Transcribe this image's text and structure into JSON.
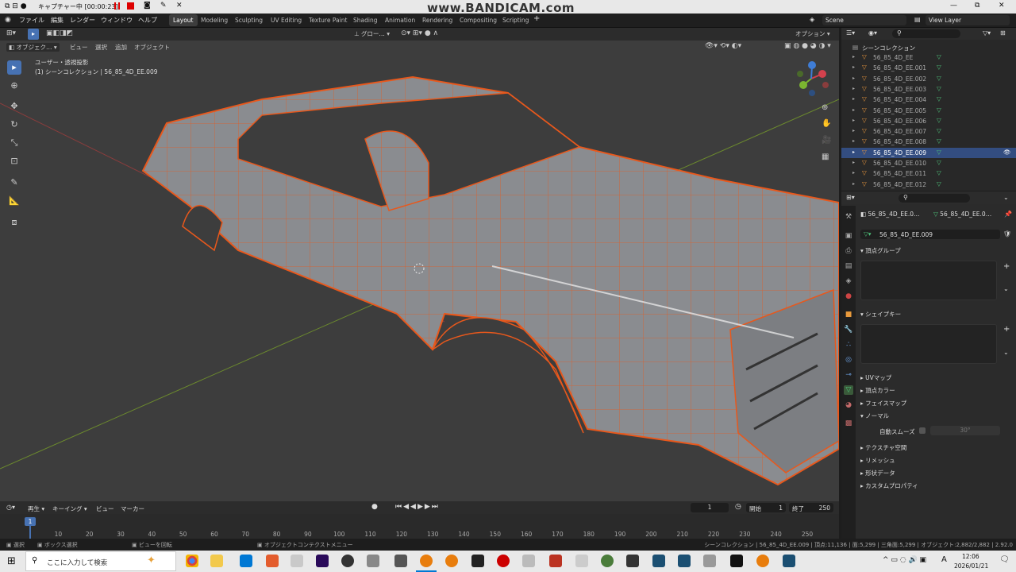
{
  "titlebar": {
    "capture": "キャプチャー中 [00:00:23]",
    "watermark": "www.BANDICAM.com"
  },
  "menu": [
    "ファイル",
    "編集",
    "レンダー",
    "ウィンドウ",
    "ヘルプ"
  ],
  "workspaces": [
    "Layout",
    "Modeling",
    "Sculpting",
    "UV Editing",
    "Texture Paint",
    "Shading",
    "Animation",
    "Rendering",
    "Compositing",
    "Scripting"
  ],
  "scene": {
    "name": "Scene",
    "view_layer": "View Layer"
  },
  "viewport": {
    "mode": "オブジェク…",
    "menus": [
      "ビュー",
      "選択",
      "追加",
      "オブジェクト"
    ],
    "transform": "グロー…",
    "options": "オプション",
    "view_label": "ユーザー・透視投影",
    "collection_label": "(1) シーンコレクション | 56_85_4D_EE.009"
  },
  "outliner": {
    "root": "シーンコレクション",
    "items": [
      "56_85_4D_EE",
      "56_85_4D_EE.001",
      "56_85_4D_EE.002",
      "56_85_4D_EE.003",
      "56_85_4D_EE.004",
      "56_85_4D_EE.005",
      "56_85_4D_EE.006",
      "56_85_4D_EE.007",
      "56_85_4D_EE.008",
      "56_85_4D_EE.009",
      "56_85_4D_EE.010",
      "56_85_4D_EE.011",
      "56_85_4D_EE.012"
    ],
    "selected_index": 9
  },
  "properties": {
    "object_name": "56_85_4D_EE.0…",
    "mesh_name": "56_85_4D_EE.0…",
    "data_name": "56_85_4D_EE.009",
    "vertex_groups": "頂点グループ",
    "shape_keys": "シェイプキー",
    "sections": [
      "UVマップ",
      "頂点カラー",
      "フェイスマップ",
      "ノーマル"
    ],
    "auto_smooth_label": "自動スムーズ",
    "auto_smooth_angle": "30°",
    "sections2": [
      "テクスチャ空間",
      "リメッシュ",
      "形状データ",
      "カスタムプロパティ"
    ]
  },
  "timeline": {
    "menus": [
      "再生",
      "キーイング",
      "ビュー",
      "マーカー"
    ],
    "current_frame": "1",
    "start_label": "開始",
    "start": "1",
    "end_label": "終了",
    "end": "250",
    "ticks": [
      "10",
      "20",
      "30",
      "40",
      "50",
      "60",
      "70",
      "80",
      "90",
      "100",
      "110",
      "120",
      "130",
      "140",
      "150",
      "160",
      "170",
      "180",
      "190",
      "200",
      "210",
      "220",
      "230",
      "240",
      "250"
    ],
    "playhead": "1"
  },
  "status": {
    "select": "選択",
    "box_select": "ボックス選択",
    "rotate_view": "ビューを回転",
    "context_menu": "オブジェクトコンテクストメニュー",
    "stats": "シーンコレクション | 56_85_4D_EE.009 | 頂点:11,136 | 面:5,299 | 三角面:5,299 | オブジェクト:2,882/2,882 | 2.92.0"
  },
  "taskbar": {
    "search_placeholder": "ここに入力して検索",
    "time": "12:06",
    "date": "2026/01/21",
    "ime": "A"
  },
  "colors": {
    "wire": "#e8581c",
    "select": "#4772b3",
    "outliner_sel": "#334d80"
  }
}
